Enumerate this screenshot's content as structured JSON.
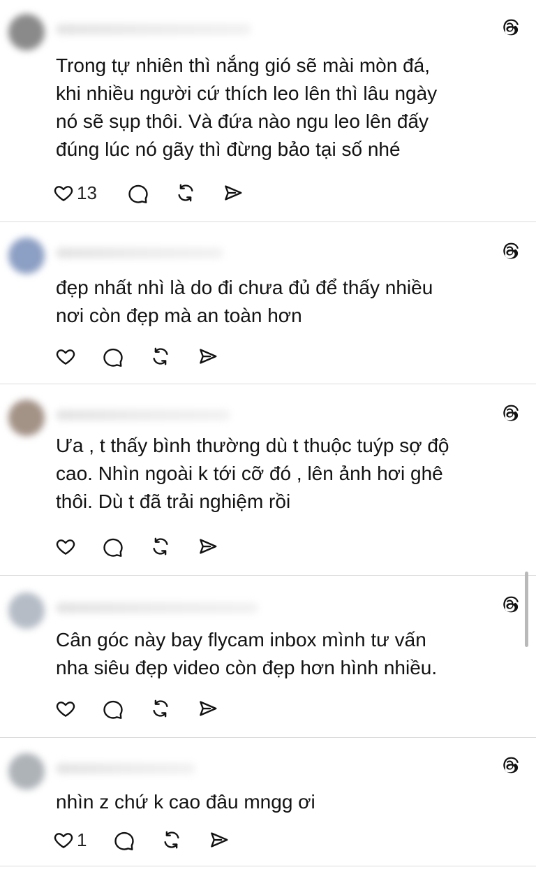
{
  "comments": [
    {
      "text": "Trong tự nhiên thì nắng gió sẽ mài mòn đá,\nkhi nhiều người cứ thích leo lên thì lâu ngày\nnó sẽ sụp thôi. Và đứa nào ngu leo lên đấy\nđúng lúc nó gãy thì đừng bảo tại số nhé",
      "like_count": "13",
      "avatar_color": "#8a8a8a"
    },
    {
      "text": "đẹp nhất nhì là do đi chưa đủ để thấy nhiều\nnơi còn đẹp mà an toàn hơn",
      "like_count": "",
      "avatar_color": "#8c9fc4"
    },
    {
      "text": "Ưa , t thấy bình thường dù t thuộc tuýp sợ độ\ncao. Nhìn ngoài k tới cỡ đó , lên ảnh hơi ghê\nthôi. Dù t đã trải nghiệm rồi",
      "like_count": "",
      "avatar_color": "#a39286"
    },
    {
      "text": "Cân góc này bay flycam inbox mình tư vấn\nnha siêu đẹp video còn đẹp hơn hình nhiều.",
      "like_count": "",
      "avatar_color": "#b5bcc6"
    },
    {
      "text": "nhìn z chứ k cao đâu mngg ơi",
      "like_count": "1",
      "avatar_color": "#aeb3b8"
    }
  ],
  "icons": {
    "header_right": "threads-logo-icon",
    "like": "heart-icon",
    "reply": "comment-bubble-icon",
    "repost": "repost-icon",
    "share": "send-icon"
  }
}
